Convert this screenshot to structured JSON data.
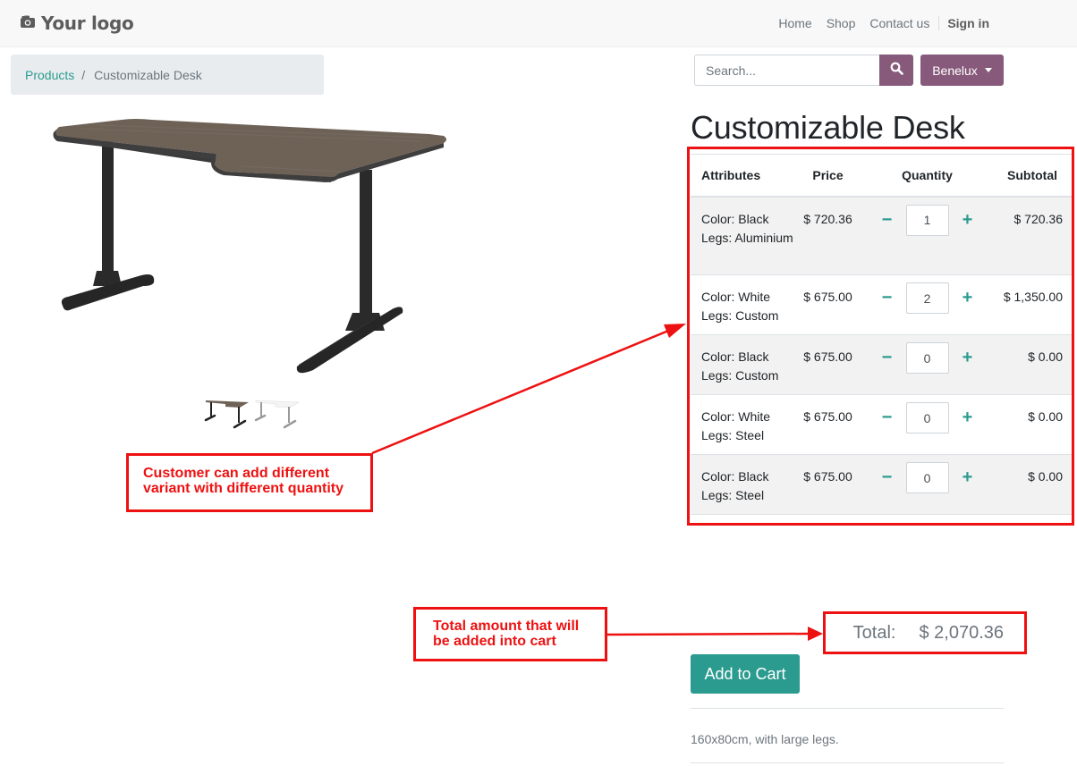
{
  "header": {
    "logo_text": "Your logo",
    "nav": [
      {
        "label": "Home"
      },
      {
        "label": "Shop"
      },
      {
        "label": "Contact us"
      },
      {
        "label": "Sign in"
      }
    ]
  },
  "breadcrumb": {
    "link": "Products",
    "separator": "/",
    "current": "Customizable Desk"
  },
  "search": {
    "placeholder": "Search...",
    "pricelist_label": "Benelux"
  },
  "product": {
    "title": "Customizable Desk",
    "description": "160x80cm, with large legs.",
    "add_to_cart_label": "Add to Cart"
  },
  "variant_table": {
    "headers": {
      "attributes": "Attributes",
      "price": "Price",
      "quantity": "Quantity",
      "subtotal": "Subtotal"
    },
    "rows": [
      {
        "color": "Color: Black",
        "legs": "Legs: Aluminium",
        "price": "$ 720.36",
        "qty": "1",
        "subtotal": "$ 720.36"
      },
      {
        "color": "Color: White",
        "legs": "Legs: Custom",
        "price": "$ 675.00",
        "qty": "2",
        "subtotal": "$ 1,350.00"
      },
      {
        "color": "Color: Black",
        "legs": "Legs: Custom",
        "price": "$ 675.00",
        "qty": "0",
        "subtotal": "$ 0.00"
      },
      {
        "color": "Color: White",
        "legs": "Legs: Steel",
        "price": "$ 675.00",
        "qty": "0",
        "subtotal": "$ 0.00"
      },
      {
        "color": "Color: Black",
        "legs": "Legs: Steel",
        "price": "$ 675.00",
        "qty": "0",
        "subtotal": "$ 0.00"
      }
    ]
  },
  "total": {
    "label": "Total:",
    "amount": "$ 2,070.36"
  },
  "annotations": {
    "variant_callout_line1": "Customer can add different",
    "variant_callout_line2": "variant with different quantity",
    "total_callout_line1": "Total amount that will",
    "total_callout_line2": "be added into cart",
    "color": "#ee1111"
  },
  "theme": {
    "primary": "#875a7b",
    "accent": "#2b9b8f"
  }
}
